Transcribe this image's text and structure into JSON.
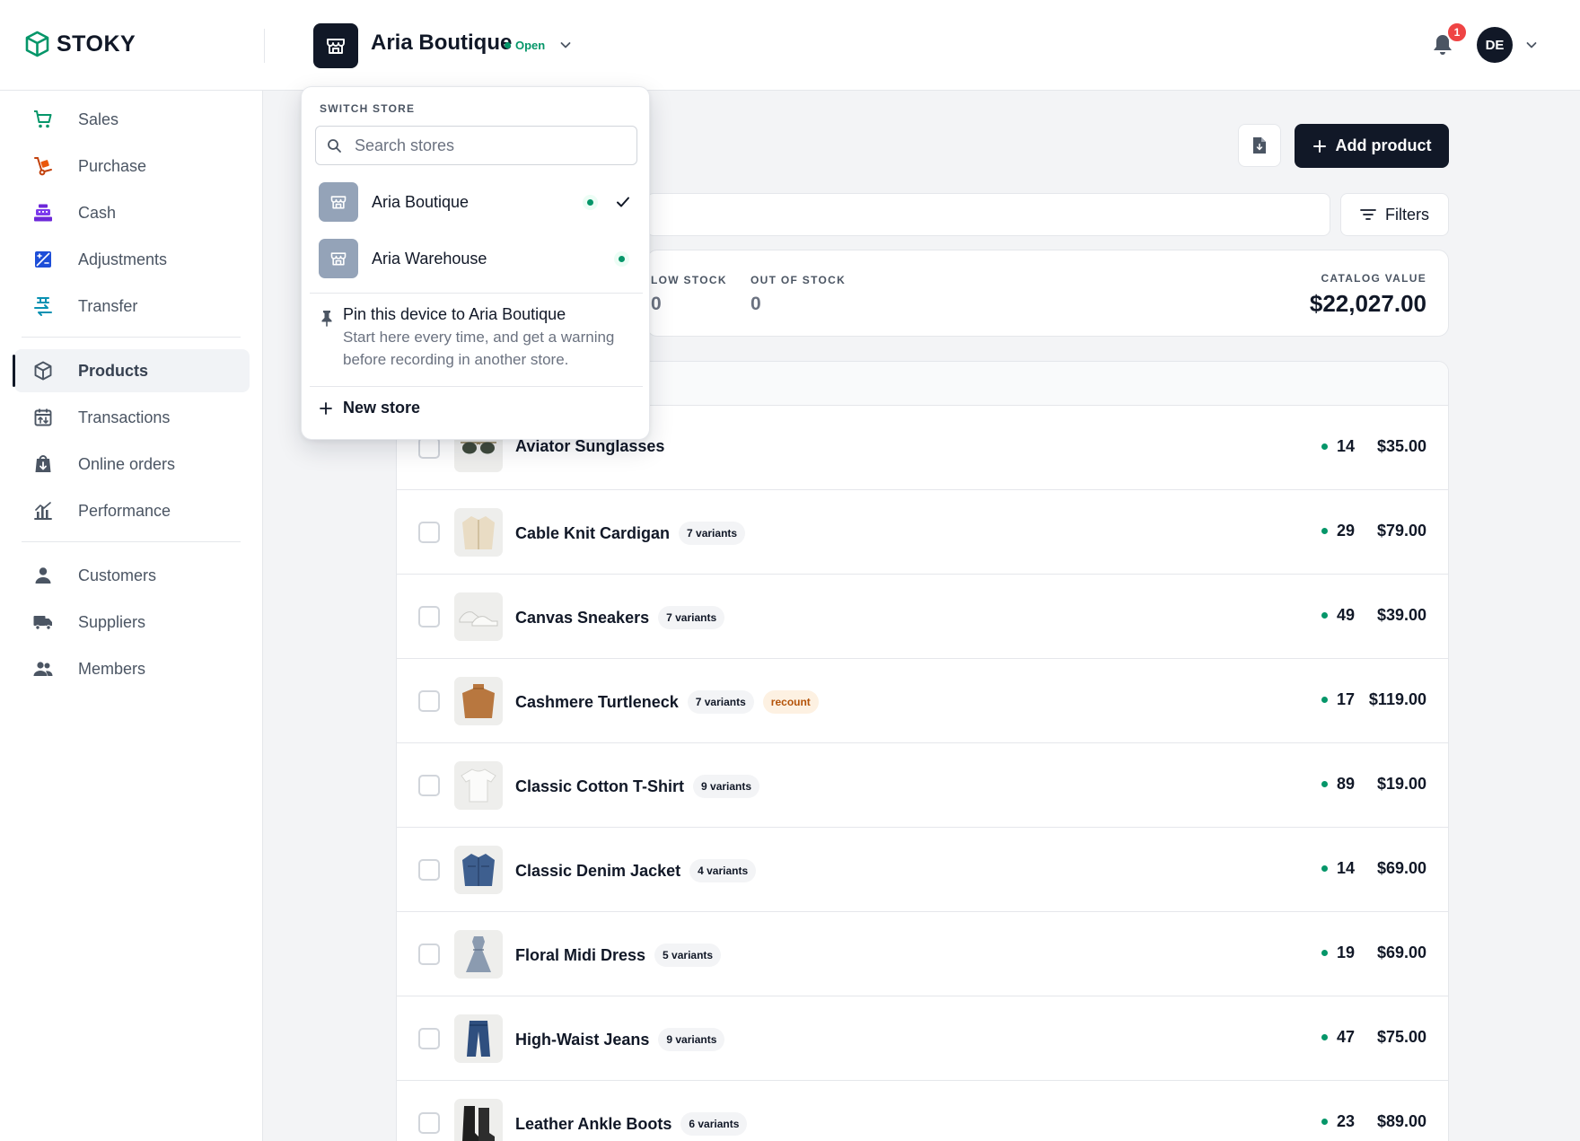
{
  "brand": {
    "name": "STOKY",
    "accent": "#059669"
  },
  "header": {
    "store_name": "Aria Boutique",
    "store_status": "Open",
    "notification_count": "1",
    "user_initials": "DE"
  },
  "sidebar": {
    "items": [
      {
        "label": "Sales",
        "icon": "cart-icon"
      },
      {
        "label": "Purchase",
        "icon": "hand-truck-icon"
      },
      {
        "label": "Cash",
        "icon": "cash-register-icon"
      },
      {
        "label": "Adjustments",
        "icon": "adjustments-icon"
      },
      {
        "label": "Transfer",
        "icon": "transfer-icon"
      },
      {
        "label": "Products",
        "icon": "box-icon",
        "active": true
      },
      {
        "label": "Transactions",
        "icon": "calendar-icon"
      },
      {
        "label": "Online orders",
        "icon": "online-order-icon"
      },
      {
        "label": "Performance",
        "icon": "chart-icon"
      },
      {
        "label": "Customers",
        "icon": "person-icon"
      },
      {
        "label": "Suppliers",
        "icon": "truck-icon"
      },
      {
        "label": "Members",
        "icon": "people-icon"
      }
    ]
  },
  "toolbar": {
    "add_product_label": "Add product",
    "filters_label": "Filters"
  },
  "stats": {
    "low_stock_label": "LOW STOCK",
    "low_stock_value": "0",
    "out_of_stock_label": "OUT OF STOCK",
    "out_of_stock_value": "0",
    "catalog_value_label": "CATALOG VALUE",
    "catalog_value": "$22,027.00"
  },
  "products": [
    {
      "name": "Aviator Sunglasses",
      "variants": "",
      "tag": "",
      "stock": "14",
      "price": "$35.00"
    },
    {
      "name": "Cable Knit Cardigan",
      "variants": "7 variants",
      "tag": "",
      "stock": "29",
      "price": "$79.00"
    },
    {
      "name": "Canvas Sneakers",
      "variants": "7 variants",
      "tag": "",
      "stock": "49",
      "price": "$39.00"
    },
    {
      "name": "Cashmere Turtleneck",
      "variants": "7 variants",
      "tag": "recount",
      "stock": "17",
      "price": "$119.00"
    },
    {
      "name": "Classic Cotton T-Shirt",
      "variants": "9 variants",
      "tag": "",
      "stock": "89",
      "price": "$19.00"
    },
    {
      "name": "Classic Denim Jacket",
      "variants": "4 variants",
      "tag": "",
      "stock": "14",
      "price": "$69.00"
    },
    {
      "name": "Floral Midi Dress",
      "variants": "5 variants",
      "tag": "",
      "stock": "19",
      "price": "$69.00"
    },
    {
      "name": "High-Waist Jeans",
      "variants": "9 variants",
      "tag": "",
      "stock": "47",
      "price": "$75.00"
    },
    {
      "name": "Leather Ankle Boots",
      "variants": "6 variants",
      "tag": "",
      "stock": "23",
      "price": "$89.00"
    }
  ],
  "switcher": {
    "title": "SWITCH STORE",
    "search_placeholder": "Search stores",
    "stores": [
      {
        "name": "Aria Boutique",
        "selected": true
      },
      {
        "name": "Aria Warehouse",
        "selected": false
      }
    ],
    "pin_title": "Pin this device to Aria Boutique",
    "pin_desc": "Start here every time, and get a warning before recording in another store.",
    "new_store_label": "New store"
  }
}
